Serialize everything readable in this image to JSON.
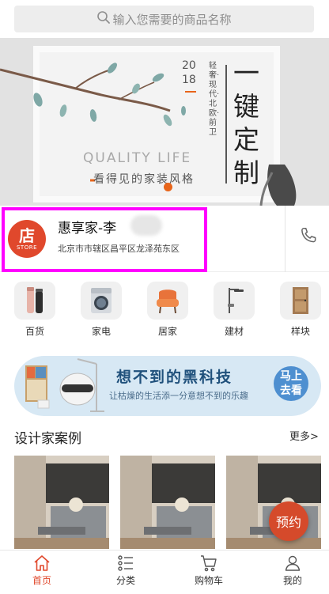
{
  "search": {
    "placeholder": "输入您需要的商品名称",
    "icon": "search-icon"
  },
  "banner": {
    "quality": "QUALITY LIFE",
    "slogan": "看得见的家装风格",
    "year_top": "20",
    "year_bottom": "18",
    "styles_vertical": "轻奢·现代·北欧·前卫",
    "headline_vertical": "一键定制",
    "accent_color": "#e8651a"
  },
  "store": {
    "logo_char": "店",
    "logo_en": "STORE",
    "name": "惠享家-李",
    "address": "北京市市辖区昌平区龙泽苑东区",
    "logo_color": "#e0482c",
    "highlight_color": "#ff00ff",
    "phone_icon": "phone-icon"
  },
  "categories": [
    {
      "label": "百货",
      "icon": "thermos-icon"
    },
    {
      "label": "家电",
      "icon": "washing-machine-icon"
    },
    {
      "label": "居家",
      "icon": "armchair-icon"
    },
    {
      "label": "建材",
      "icon": "shower-icon"
    },
    {
      "label": "样块",
      "icon": "door-icon"
    }
  ],
  "promo": {
    "title": "想不到的黑科技",
    "subtitle": "让枯燥的生活添一分意想不到的乐趣",
    "button": "马上去看",
    "button_line1": "马上",
    "button_line2": "去看"
  },
  "section": {
    "title": "设计家案例",
    "more": "更多>"
  },
  "reserve": "预约",
  "tabs": [
    {
      "label": "首页",
      "icon": "home-icon",
      "active": true
    },
    {
      "label": "分类",
      "icon": "list-icon",
      "active": false
    },
    {
      "label": "购物车",
      "icon": "cart-icon",
      "active": false
    },
    {
      "label": "我的",
      "icon": "user-icon",
      "active": false
    }
  ]
}
